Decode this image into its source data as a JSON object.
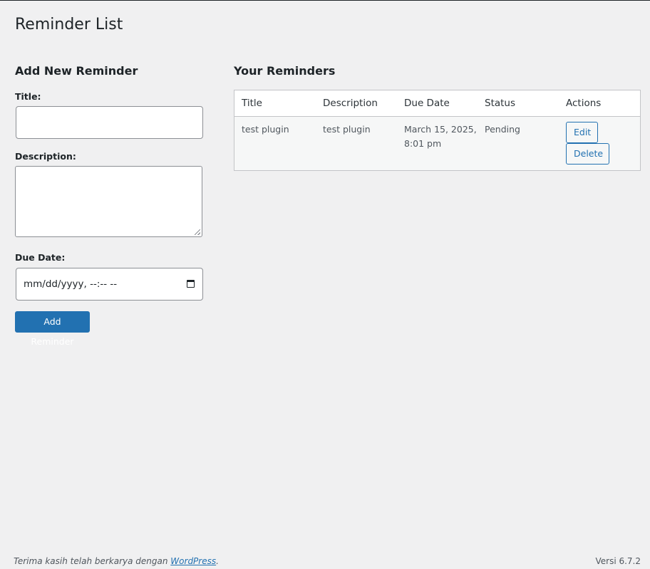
{
  "page": {
    "title": "Reminder List"
  },
  "form": {
    "heading": "Add New Reminder",
    "title_label": "Title:",
    "title_value": "",
    "description_label": "Description:",
    "description_value": "",
    "due_date_label": "Due Date:",
    "due_date_placeholder": "mm/dd/yyyy, --:-- --",
    "submit_label": "Add Reminder",
    "calendar_icon": "calendar-icon"
  },
  "list": {
    "heading": "Your Reminders",
    "columns": [
      "Title",
      "Description",
      "Due Date",
      "Status",
      "Actions"
    ],
    "rows": [
      {
        "title": "test plugin",
        "description": "test plugin",
        "due_date": "March 15, 2025, 8:01 pm",
        "status": "Pending",
        "edit_label": "Edit",
        "delete_label": "Delete"
      }
    ]
  },
  "footer": {
    "thanks_text": "Terima kasih telah berkarya dengan ",
    "link_text": "WordPress",
    "thanks_suffix": ".",
    "version": "Versi 6.7.2"
  },
  "colors": {
    "accent": "#2271b1",
    "background": "#f0f0f1",
    "text": "#1d2327"
  }
}
